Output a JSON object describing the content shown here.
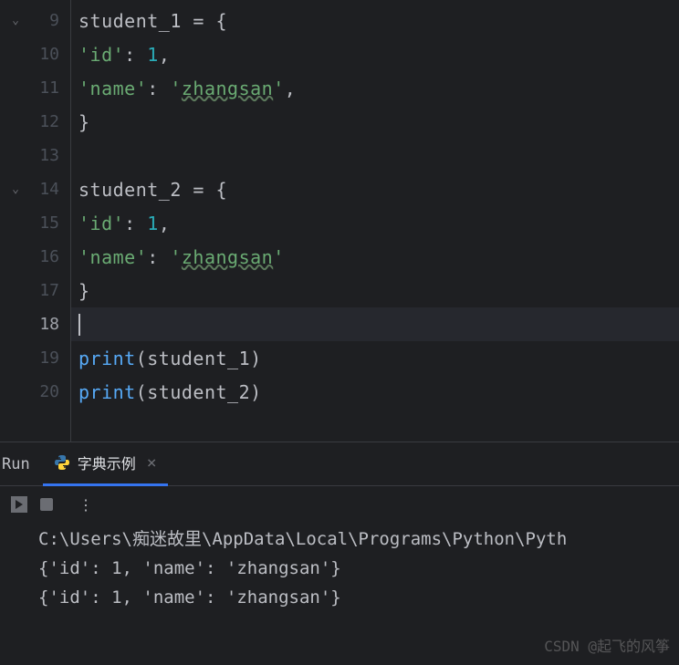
{
  "editor": {
    "lines": [
      {
        "num": "9",
        "fold": true
      },
      {
        "num": "10"
      },
      {
        "num": "11"
      },
      {
        "num": "12"
      },
      {
        "num": "13"
      },
      {
        "num": "14",
        "fold": true
      },
      {
        "num": "15"
      },
      {
        "num": "16"
      },
      {
        "num": "17"
      },
      {
        "num": "18",
        "current": true
      },
      {
        "num": "19"
      },
      {
        "num": "20"
      }
    ],
    "code": {
      "l9_var": "student_1",
      "l9_rest": " = {",
      "l10_key": "'id'",
      "l10_sep": ": ",
      "l10_val": "1",
      "l10_end": ",",
      "l11_key": "'name'",
      "l11_sep": ": ",
      "l11_q1": "'",
      "l11_val": "zhangsan",
      "l11_q2": "'",
      "l11_end": ",",
      "l12_close": "}",
      "l14_var": "student_2",
      "l14_rest": " = {",
      "l15_key": "'id'",
      "l15_sep": ": ",
      "l15_val": "1",
      "l15_end": ",",
      "l16_key": "'name'",
      "l16_sep": ": ",
      "l16_q1": "'",
      "l16_val": "zhangsan",
      "l16_q2": "'",
      "l17_close": "}",
      "l19_func": "print",
      "l19_paren1": "(",
      "l19_arg": "student_1",
      "l19_paren2": ")",
      "l20_func": "print",
      "l20_paren1": "(",
      "l20_arg": "student_2",
      "l20_paren2": ")"
    }
  },
  "panel": {
    "run_label": "Run",
    "tab_name": "字典示例",
    "tab_close": "×",
    "more_dots": "⋮"
  },
  "console": {
    "line1": "C:\\Users\\痴迷故里\\AppData\\Local\\Programs\\Python\\Pyth",
    "line2": "{'id': 1, 'name': 'zhangsan'}",
    "line3": "{'id': 1, 'name': 'zhangsan'}"
  },
  "watermark": "CSDN @起飞的风筝"
}
